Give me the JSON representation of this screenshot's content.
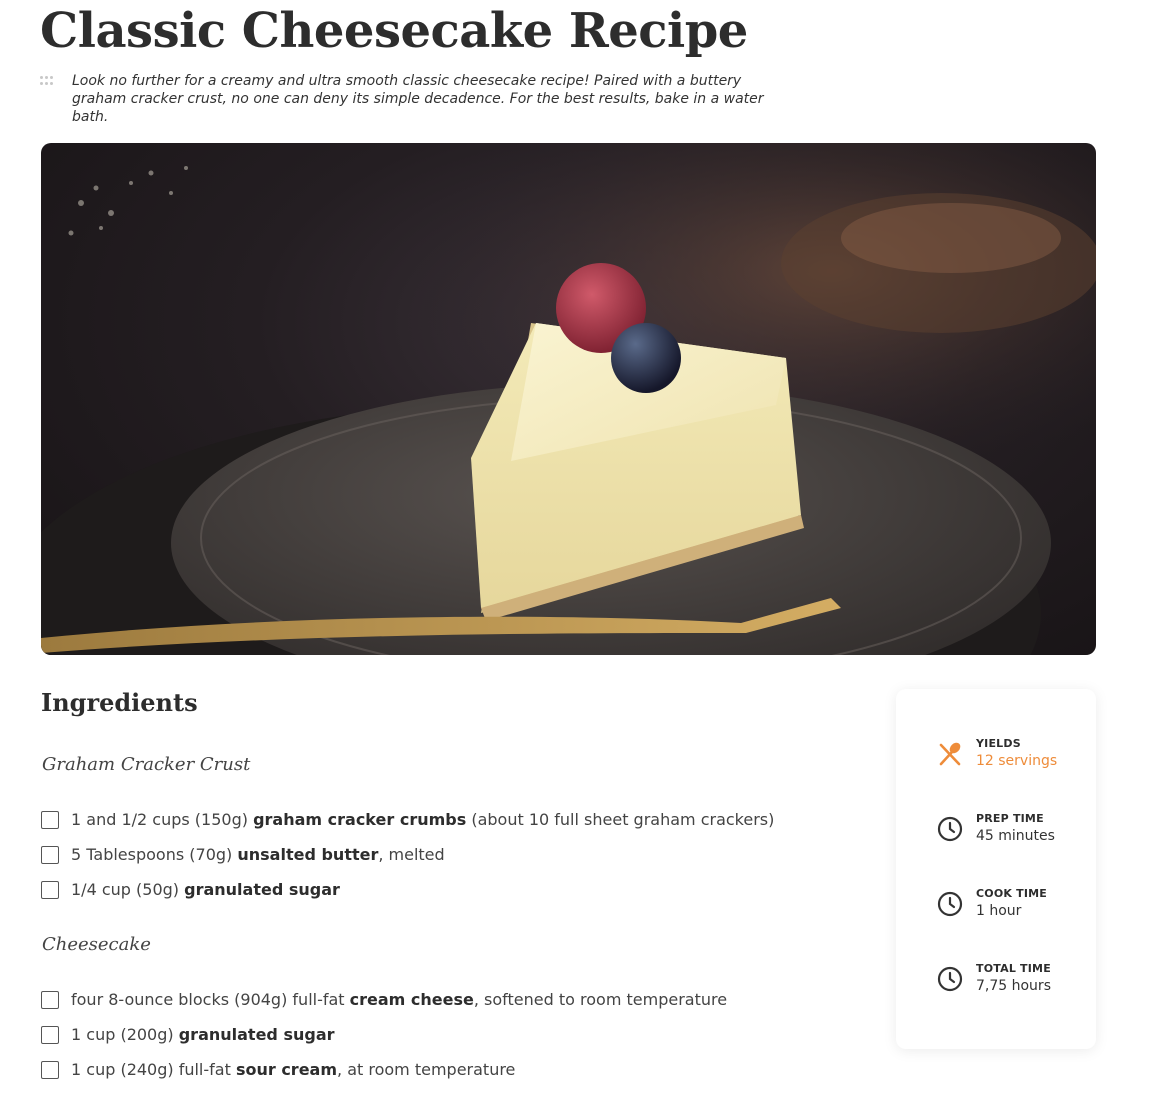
{
  "recipe": {
    "title": "Classic Cheesecake Recipe",
    "intro": "Look no further for a creamy and ultra smooth classic cheesecake recipe! Paired with a buttery graham cracker crust, no one can deny its simple decadence. For the best results, bake in a water bath.",
    "image_alt": "Slice of classic cheesecake topped with a raspberry and blueberry on a dark plate with a gold fork"
  },
  "ingredients": {
    "heading": "Ingredients",
    "groups": [
      {
        "title": "Graham Cracker Crust",
        "items": [
          {
            "pre": "1 and 1/2 cups (150g) ",
            "bold": "graham cracker crumbs",
            "post": " (about 10 full sheet graham crackers)"
          },
          {
            "pre": "5 Tablespoons (70g) ",
            "bold": "unsalted butter",
            "post": ", melted"
          },
          {
            "pre": "1/4 cup (50g) ",
            "bold": "granulated sugar",
            "post": ""
          }
        ]
      },
      {
        "title": "Cheesecake",
        "items": [
          {
            "pre": "four 8-ounce blocks (904g) full-fat ",
            "bold": "cream cheese",
            "post": ", softened to room temperature"
          },
          {
            "pre": "1 cup (200g) ",
            "bold": "granulated sugar",
            "post": ""
          },
          {
            "pre": "1 cup (240g) full-fat ",
            "bold": "sour cream",
            "post": ", at room temperature"
          }
        ]
      }
    ]
  },
  "stats": {
    "yields": {
      "label": "YIELDS",
      "value": "12 servings",
      "icon": "utensils-icon"
    },
    "prep": {
      "label": "PREP TIME",
      "value": "45 minutes",
      "icon": "clock-icon"
    },
    "cook": {
      "label": "COOK TIME",
      "value": "1 hour",
      "icon": "clock-icon"
    },
    "total": {
      "label": "TOTAL TIME",
      "value": "7,75 hours",
      "icon": "clock-icon"
    }
  },
  "colors": {
    "accent": "#ee8c3a",
    "text": "#333333",
    "heading": "#2d2d2d"
  }
}
